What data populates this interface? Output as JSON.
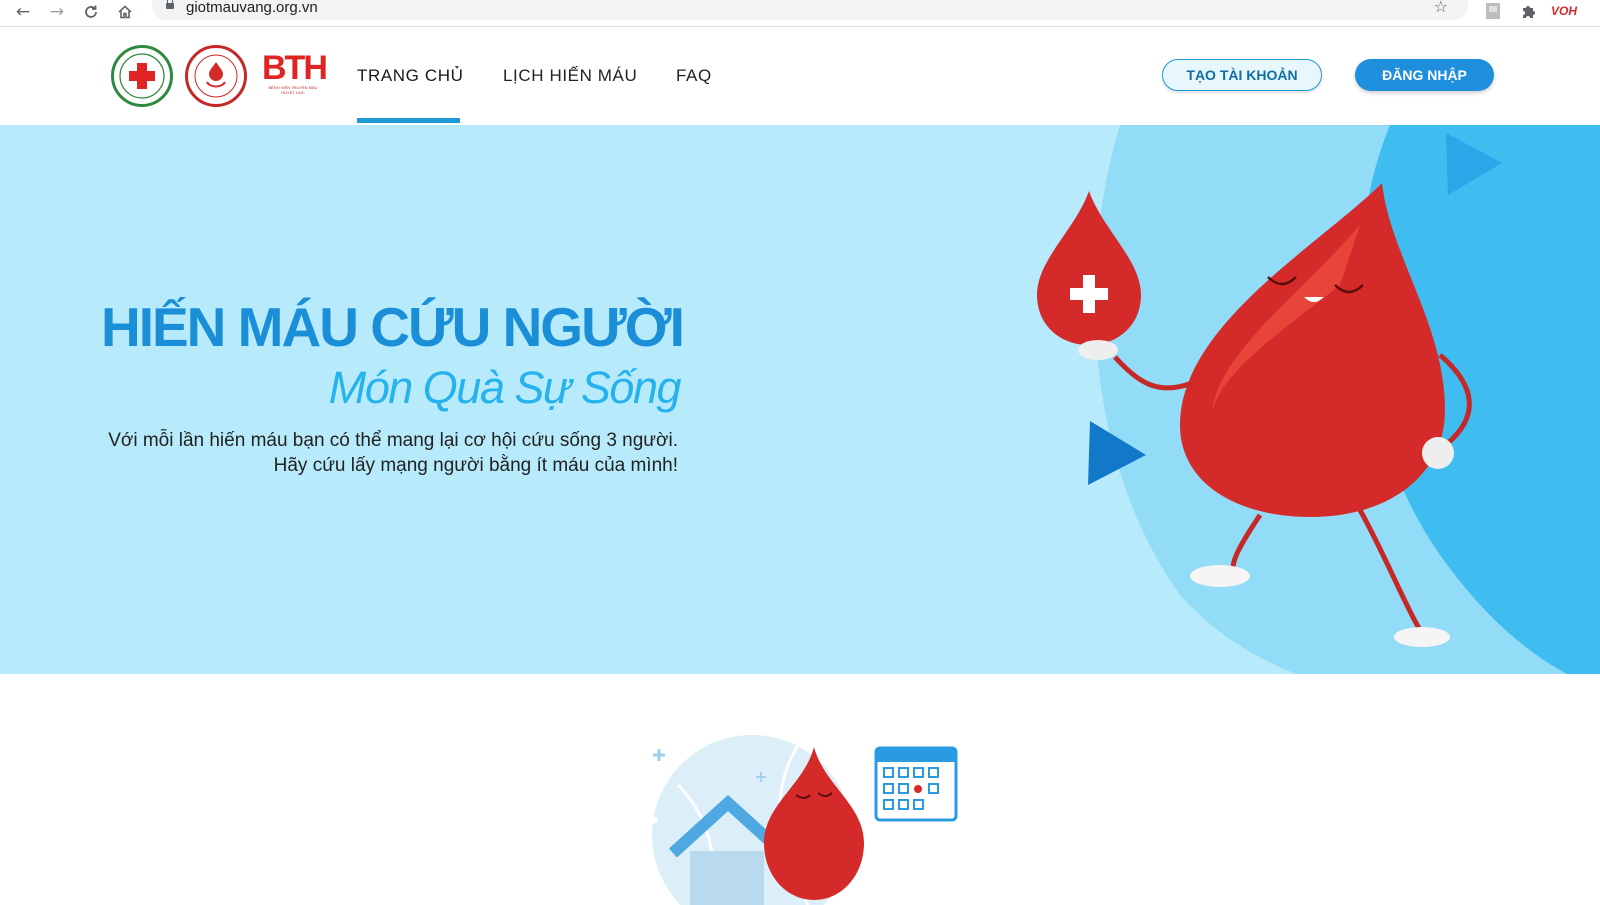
{
  "browser": {
    "url": "giotmauvang.org.vn",
    "back_icon": "arrow-left-icon",
    "forward_icon": "arrow-right-icon",
    "reload_icon": "reload-icon",
    "home_icon": "home-icon",
    "lock_icon": "lock-icon",
    "bookmark_icon": "star-icon",
    "extensions_icon": "puzzle-icon",
    "voh_label": "VOH"
  },
  "header": {
    "logos": {
      "bth_text": "BTH",
      "bth_caption": "BỆNH VIỆN TRUYỀN MÁU HUYẾT HỌC"
    },
    "nav": [
      {
        "label": "TRANG CHỦ",
        "active": true
      },
      {
        "label": "LỊCH HIẾN MÁU",
        "active": false
      },
      {
        "label": "FAQ",
        "active": false
      }
    ],
    "create_account": "TẠO TÀI KHOẢN",
    "login": "ĐĂNG NHẬP"
  },
  "hero": {
    "title": "HIẾN MÁU CỨU NGƯỜI",
    "subtitle": "Món Quà Sự Sống",
    "description_line1": "Với mỗi lần hiến máu bạn có thể mang lại cơ hội cứu sống 3 người.",
    "description_line2": "Hãy cứu lấy mạng người bằng ít máu của mình!"
  },
  "colors": {
    "accent": "#1d9ad6",
    "hero_bg": "#b7ebfc",
    "blood_red": "#d32a2a"
  }
}
